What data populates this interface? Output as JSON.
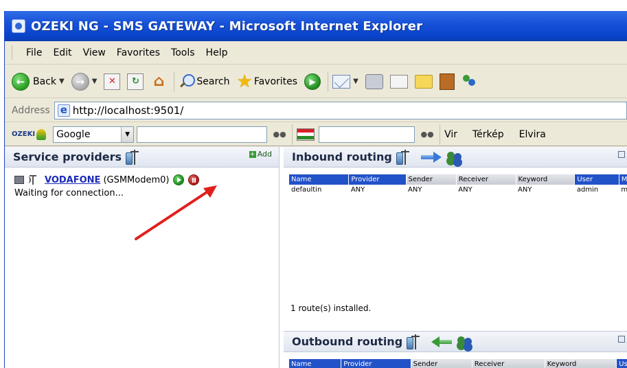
{
  "window": {
    "title": "OZEKI NG - SMS GATEWAY - Microsoft Internet Explorer"
  },
  "menu": [
    "File",
    "Edit",
    "View",
    "Favorites",
    "Tools",
    "Help"
  ],
  "toolbar": {
    "back_label": "Back",
    "search_label": "Search",
    "favorites_label": "Favorites"
  },
  "address": {
    "label": "Address",
    "url": "http://localhost:9501/"
  },
  "ozeki_bar": {
    "logo": "OZEKI",
    "engine": "Google",
    "links": [
      "Vir",
      "Térkép",
      "Elvira"
    ]
  },
  "service_providers": {
    "title": "Service providers",
    "add_label": "Add",
    "provider_name": "VODAFONE",
    "provider_type": "(GSMModem0)",
    "status": "Waiting for connection..."
  },
  "inbound": {
    "title": "Inbound routing",
    "columns": [
      "Name",
      "Provider",
      "Sender",
      "Receiver",
      "Keyword",
      "User",
      "Mode"
    ],
    "highlighted_columns": [
      "Name",
      "Provider",
      "User",
      "Mode"
    ],
    "rows": [
      [
        "defaultin",
        "ANY",
        "ANY",
        "ANY",
        "ANY",
        "admin",
        "move"
      ]
    ],
    "count_text": "1 route(s) installed."
  },
  "outbound": {
    "title": "Outbound routing",
    "columns": [
      "Name",
      "Provider",
      "Sender",
      "Receiver",
      "Keyword",
      "User"
    ],
    "highlighted_columns": [
      "Name",
      "Provider",
      "User"
    ]
  },
  "colors": {
    "titlebar": "#0a44cc",
    "link": "#1a2ab8",
    "annotation_arrow": "#e0201c",
    "table_header_highlight": "#2252c8"
  }
}
